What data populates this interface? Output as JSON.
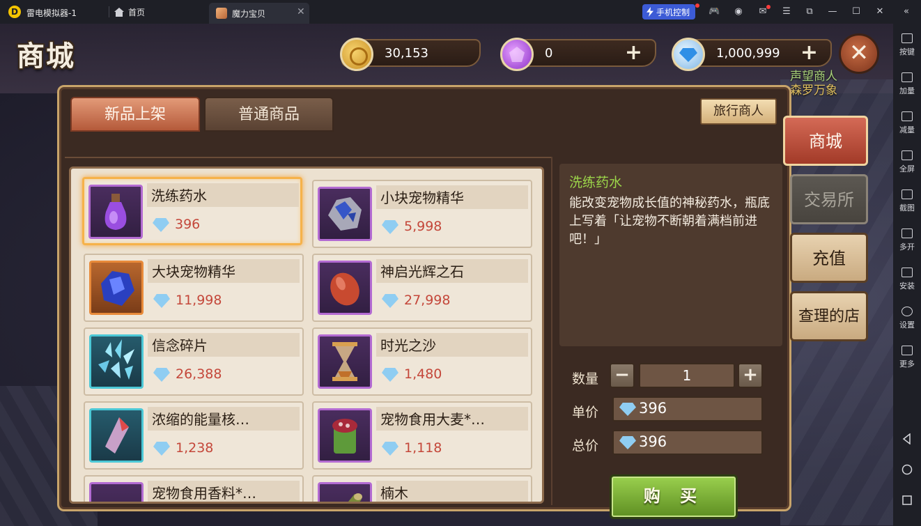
{
  "emulator": {
    "app_name": "雷电模拟器-1",
    "home_tab": "首页",
    "game_tab": "魔力宝贝",
    "phone_control": "手机控制",
    "sidebar": [
      "按键",
      "加量",
      "减量",
      "全屏",
      "截图",
      "多开",
      "安装",
      "设置",
      "更多"
    ]
  },
  "shop": {
    "title": "商城",
    "currencies": {
      "gold": "30,153",
      "crystal": "0",
      "diamond": "1,000,999"
    },
    "merchant": {
      "name": "声望商人",
      "sub": "森罗万象"
    },
    "tabs": {
      "new": "新品上架",
      "normal": "普通商品"
    },
    "travel_merchant": "旅行商人",
    "side_tabs": [
      "商城",
      "交易所",
      "充值",
      "查理的店"
    ],
    "items": [
      {
        "name": "洗练药水",
        "price": "396"
      },
      {
        "name": "小块宠物精华",
        "price": "5,998"
      },
      {
        "name": "大块宠物精华",
        "price": "11,998"
      },
      {
        "name": "神启光辉之石",
        "price": "27,998"
      },
      {
        "name": "信念碎片",
        "price": "26,388"
      },
      {
        "name": "时光之沙",
        "price": "1,480"
      },
      {
        "name": "浓缩的能量核…",
        "price": "1,238"
      },
      {
        "name": "宠物食用大麦*…",
        "price": "1,118"
      },
      {
        "name": "宠物食用香料*…",
        "price": ""
      },
      {
        "name": "楠木",
        "price": ""
      }
    ],
    "detail": {
      "name": "洗练药水",
      "description": "能改变宠物成长值的神秘药水，瓶底上写着「让宠物不断朝着满档前进吧！」"
    },
    "quantity_label": "数量",
    "quantity": "1",
    "unit_price_label": "单价",
    "unit_price": "396",
    "total_price_label": "总价",
    "total_price": "396",
    "buy_label": "购 买"
  }
}
